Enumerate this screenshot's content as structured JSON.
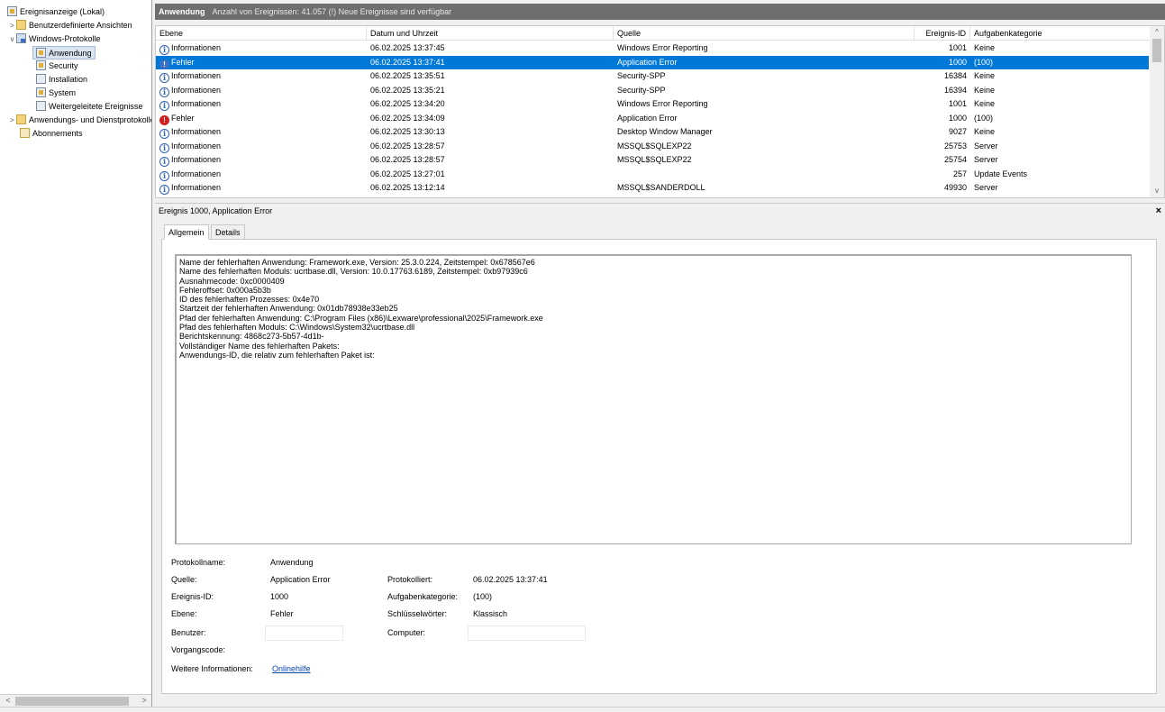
{
  "tree": {
    "items": [
      {
        "label": "Ereignisanzeige (Lokal)"
      },
      {
        "label": "Benutzerdefinierte Ansichten",
        "expander": ">"
      },
      {
        "label": "Windows-Protokolle",
        "expander": "v"
      },
      {
        "label": "Anwendung"
      },
      {
        "label": "Security"
      },
      {
        "label": "Installation"
      },
      {
        "label": "System"
      },
      {
        "label": "Weitergeleitete Ereignisse"
      },
      {
        "label": "Anwendungs- und Dienstprotokolle",
        "expander": ">"
      },
      {
        "label": "Abonnements"
      }
    ],
    "scroll_left": "<",
    "scroll_right": ">"
  },
  "header": {
    "title": "Anwendung",
    "count_text": "Anzahl von Ereignissen: 41.057 (!) Neue Ereignisse sind verfügbar"
  },
  "grid": {
    "columns": [
      "Ebene",
      "Datum und Uhrzeit",
      "Quelle",
      "Ereignis-ID",
      "Aufgabenkategorie"
    ],
    "rows": [
      {
        "level": "Informationen",
        "date": "06.02.2025 13:37:45",
        "source": "Windows Error Reporting",
        "id": "1001",
        "category": "Keine"
      },
      {
        "level": "Fehler",
        "date": "06.02.2025 13:37:41",
        "source": "Application Error",
        "id": "1000",
        "category": "(100)"
      },
      {
        "level": "Informationen",
        "date": "06.02.2025 13:35:51",
        "source": "Security-SPP",
        "id": "16384",
        "category": "Keine"
      },
      {
        "level": "Informationen",
        "date": "06.02.2025 13:35:21",
        "source": "Security-SPP",
        "id": "16394",
        "category": "Keine"
      },
      {
        "level": "Informationen",
        "date": "06.02.2025 13:34:20",
        "source": "Windows Error Reporting",
        "id": "1001",
        "category": "Keine"
      },
      {
        "level": "Fehler",
        "date": "06.02.2025 13:34:09",
        "source": "Application Error",
        "id": "1000",
        "category": "(100)"
      },
      {
        "level": "Informationen",
        "date": "06.02.2025 13:30:13",
        "source": "Desktop Window Manager",
        "id": "9027",
        "category": "Keine"
      },
      {
        "level": "Informationen",
        "date": "06.02.2025 13:28:57",
        "source": "MSSQL$SQLEXP22",
        "id": "25753",
        "category": "Server"
      },
      {
        "level": "Informationen",
        "date": "06.02.2025 13:28:57",
        "source": "MSSQL$SQLEXP22",
        "id": "25754",
        "category": "Server"
      },
      {
        "level": "Informationen",
        "date": "06.02.2025 13:27:01",
        "source": "",
        "id": "257",
        "category": "Update Events"
      },
      {
        "level": "Informationen",
        "date": "06.02.2025 13:12:14",
        "source": "MSSQL$SANDERDOLL",
        "id": "49930",
        "category": "Server"
      }
    ],
    "selected_index": 1,
    "scroll_up": "^",
    "scroll_down": "v"
  },
  "detail": {
    "title": "Ereignis 1000, Application Error",
    "close": "×",
    "tabs": [
      "Allgemein",
      "Details"
    ],
    "description_lines": [
      "Name der fehlerhaften Anwendung: Framework.exe, Version: 25.3.0.224, Zeitstempel: 0x678567e6",
      "Name des fehlerhaften Moduls: ucrtbase.dll, Version: 10.0.17763.6189, Zeitstempel: 0xb97939c6",
      "Ausnahmecode: 0xc0000409",
      "Fehleroffset: 0x000a5b3b",
      "ID des fehlerhaften Prozesses: 0x4e70",
      "Startzeit der fehlerhaften Anwendung: 0x01db78938e33eb25",
      "Pfad der fehlerhaften Anwendung: C:\\Program Files (x86)\\Lexware\\professional\\2025\\Framework.exe",
      "Pfad des fehlerhaften Moduls: C:\\Windows\\System32\\ucrtbase.dll",
      "Berichtskennung: 4868c273-5b57-4d1b-",
      "Vollständiger Name des fehlerhaften Pakets:",
      "Anwendungs-ID, die relativ zum fehlerhaften Paket ist:"
    ],
    "props": {
      "protokollname_label": "Protokollname:",
      "protokollname": "Anwendung",
      "quelle_label": "Quelle:",
      "quelle": "Application Error",
      "protokolliert_label": "Protokolliert:",
      "protokolliert": "06.02.2025 13:37:41",
      "ereignis_id_label": "Ereignis-ID:",
      "ereignis_id": "1000",
      "aufgabenkategorie_label": "Aufgabenkategorie:",
      "aufgabenkategorie": "(100)",
      "ebene_label": "Ebene:",
      "ebene": "Fehler",
      "schluesselwoerter_label": "Schlüsselwörter:",
      "schluesselwoerter": "Klassisch",
      "benutzer_label": "Benutzer:",
      "computer_label": "Computer:",
      "vorgangscode_label": "Vorgangscode:",
      "weitere_label": "Weitere Informationen:",
      "onlinehilfe": "Onlinehilfe"
    }
  },
  "colors": {
    "selection": "#0078d7",
    "title_bar": "#6e6e6e",
    "error_icon": "#d11f1f",
    "info_icon": "#2d62b3",
    "link": "#0645ad"
  }
}
